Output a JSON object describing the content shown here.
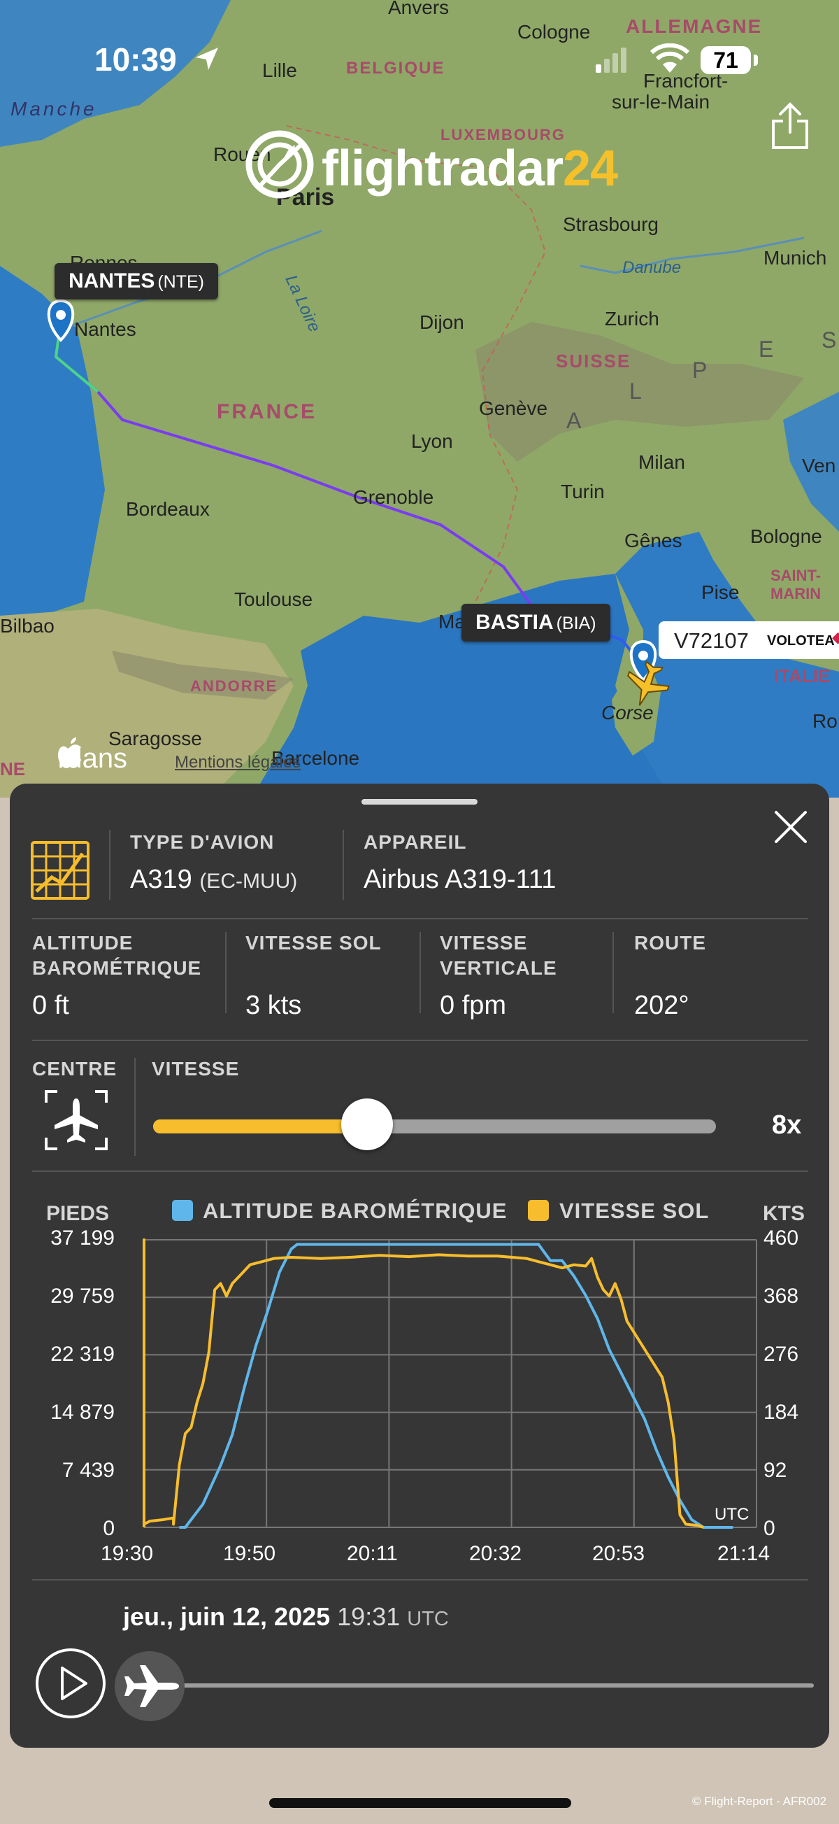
{
  "status_bar": {
    "time": "10:39",
    "battery": "71"
  },
  "brand": {
    "logo_text": "flightradar",
    "logo_number": "24"
  },
  "map": {
    "places": [
      {
        "name": "Anvers"
      },
      {
        "name": "Cologne"
      },
      {
        "name": "ALLEMAGNE"
      },
      {
        "name": "Lille"
      },
      {
        "name": "BELGIQUE"
      },
      {
        "name": "Francfort-"
      },
      {
        "name": "sur-le-Main"
      },
      {
        "name": "Manche"
      },
      {
        "name": "LUXEMBOURG"
      },
      {
        "name": "Rouen"
      },
      {
        "name": "Paris"
      },
      {
        "name": "Strasbourg"
      },
      {
        "name": "Rennes"
      },
      {
        "name": "Munich"
      },
      {
        "name": "Danube"
      },
      {
        "name": "La Loire"
      },
      {
        "name": "Dijon"
      },
      {
        "name": "Zurich"
      },
      {
        "name": "Nantes"
      },
      {
        "name": "SUISSE"
      },
      {
        "name": "FRANCE"
      },
      {
        "name": "Genève"
      },
      {
        "name": "Lyon"
      },
      {
        "name": "Milan"
      },
      {
        "name": "Bordeaux"
      },
      {
        "name": "Grenoble"
      },
      {
        "name": "Turin"
      },
      {
        "name": "Ven"
      },
      {
        "name": "Gênes"
      },
      {
        "name": "Bologne"
      },
      {
        "name": "Toulouse"
      },
      {
        "name": "Pise"
      },
      {
        "name": "SAINT-"
      },
      {
        "name": "MARIN"
      },
      {
        "name": "Bilbao"
      },
      {
        "name": "Ma"
      },
      {
        "name": "ITALIE"
      },
      {
        "name": "ANDORRE"
      },
      {
        "name": "Corse"
      },
      {
        "name": "Ro"
      },
      {
        "name": "Saragosse"
      },
      {
        "name": "Barcelone"
      },
      {
        "name": "NE"
      },
      {
        "name": "A"
      },
      {
        "name": "L"
      },
      {
        "name": "P"
      },
      {
        "name": "E"
      },
      {
        "name": "S"
      }
    ],
    "origin": {
      "city": "NANTES",
      "code": "(NTE)"
    },
    "destination": {
      "city": "BASTIA",
      "code": "(BIA)"
    },
    "flight": {
      "callsign": "V72107",
      "airline": "VOLOTEA"
    },
    "maps_brand": "Plans",
    "mentions": "Mentions légales"
  },
  "panel": {
    "aircraft_type_label": "TYPE D'AVION",
    "aircraft_type": "A319",
    "registration": "(EC-MUU)",
    "device_label": "APPAREIL",
    "device": "Airbus A319-111",
    "stats": [
      {
        "label_l1": "ALTITUDE",
        "label_l2": "BAROMÉTRIQUE",
        "value": "0 ft"
      },
      {
        "label_l1": "VITESSE SOL",
        "label_l2": "",
        "value": "3 kts"
      },
      {
        "label_l1": "VITESSE",
        "label_l2": "VERTICALE",
        "value": "0 fpm"
      },
      {
        "label_l1": "ROUTE",
        "label_l2": "",
        "value": "202°"
      }
    ],
    "center_label": "CENTRE",
    "speed_label": "VITESSE",
    "speed_value": "8x",
    "speed_slider_fraction": 0.38,
    "date": "jeu., juin 12, 2025",
    "time": "19:31",
    "tz": "UTC",
    "playback_fraction": 0.0
  },
  "chart_data": {
    "type": "line",
    "left_unit": "PIEDS",
    "right_unit": "KTS",
    "utc_note": "UTC",
    "left_ticks": [
      "37 199",
      "29 759",
      "22 319",
      "14 879",
      "7 439",
      "0"
    ],
    "right_ticks": [
      "460",
      "368",
      "276",
      "184",
      "92",
      "0"
    ],
    "x_ticks": [
      "19:30",
      "19:50",
      "20:11",
      "20:32",
      "20:53",
      "21:14"
    ],
    "x_range_minutes": [
      0,
      104
    ],
    "series": [
      {
        "name": "ALTITUDE BAROMÉTRIQUE",
        "axis": "left",
        "color": "#5fb6ea",
        "ylim": [
          0,
          37199
        ],
        "points": [
          [
            6,
            0
          ],
          [
            7,
            0
          ],
          [
            10,
            3000
          ],
          [
            13,
            8000
          ],
          [
            15,
            12000
          ],
          [
            17,
            18000
          ],
          [
            19,
            23500
          ],
          [
            21,
            28000
          ],
          [
            23,
            33000
          ],
          [
            25,
            36000
          ],
          [
            26,
            36600
          ],
          [
            30,
            36600
          ],
          [
            40,
            36600
          ],
          [
            50,
            36600
          ],
          [
            60,
            36600
          ],
          [
            67,
            36600
          ],
          [
            69,
            34500
          ],
          [
            71,
            34500
          ],
          [
            73,
            32500
          ],
          [
            75,
            30000
          ],
          [
            77,
            27000
          ],
          [
            79,
            23000
          ],
          [
            81,
            20000
          ],
          [
            83,
            17000
          ],
          [
            85,
            14000
          ],
          [
            87,
            10000
          ],
          [
            89,
            6500
          ],
          [
            91,
            3500
          ],
          [
            93,
            1000
          ],
          [
            95,
            0
          ],
          [
            100,
            0
          ]
        ]
      },
      {
        "name": "VITESSE SOL",
        "axis": "right",
        "color": "#f7bd2c",
        "ylim": [
          0,
          460
        ],
        "points": [
          [
            0,
            0
          ],
          [
            0,
            460
          ],
          [
            0,
            5
          ],
          [
            1,
            10
          ],
          [
            3,
            12
          ],
          [
            5,
            15
          ],
          [
            5,
            5
          ],
          [
            6,
            100
          ],
          [
            7,
            150
          ],
          [
            8,
            160
          ],
          [
            9,
            200
          ],
          [
            10,
            230
          ],
          [
            11,
            280
          ],
          [
            12,
            380
          ],
          [
            13,
            390
          ],
          [
            14,
            370
          ],
          [
            15,
            390
          ],
          [
            16,
            400
          ],
          [
            17,
            410
          ],
          [
            18,
            420
          ],
          [
            20,
            425
          ],
          [
            22,
            430
          ],
          [
            25,
            432
          ],
          [
            30,
            430
          ],
          [
            35,
            432
          ],
          [
            40,
            435
          ],
          [
            45,
            433
          ],
          [
            50,
            436
          ],
          [
            55,
            434
          ],
          [
            60,
            434
          ],
          [
            65,
            430
          ],
          [
            67,
            425
          ],
          [
            69,
            420
          ],
          [
            71,
            415
          ],
          [
            73,
            420
          ],
          [
            75,
            418
          ],
          [
            76,
            430
          ],
          [
            77,
            400
          ],
          [
            78,
            380
          ],
          [
            79,
            370
          ],
          [
            80,
            390
          ],
          [
            81,
            365
          ],
          [
            82,
            330
          ],
          [
            84,
            300
          ],
          [
            86,
            270
          ],
          [
            88,
            240
          ],
          [
            89,
            200
          ],
          [
            90,
            140
          ],
          [
            90.5,
            80
          ],
          [
            91,
            20
          ],
          [
            92,
            5
          ],
          [
            94,
            3
          ],
          [
            95,
            0
          ]
        ]
      }
    ]
  }
}
